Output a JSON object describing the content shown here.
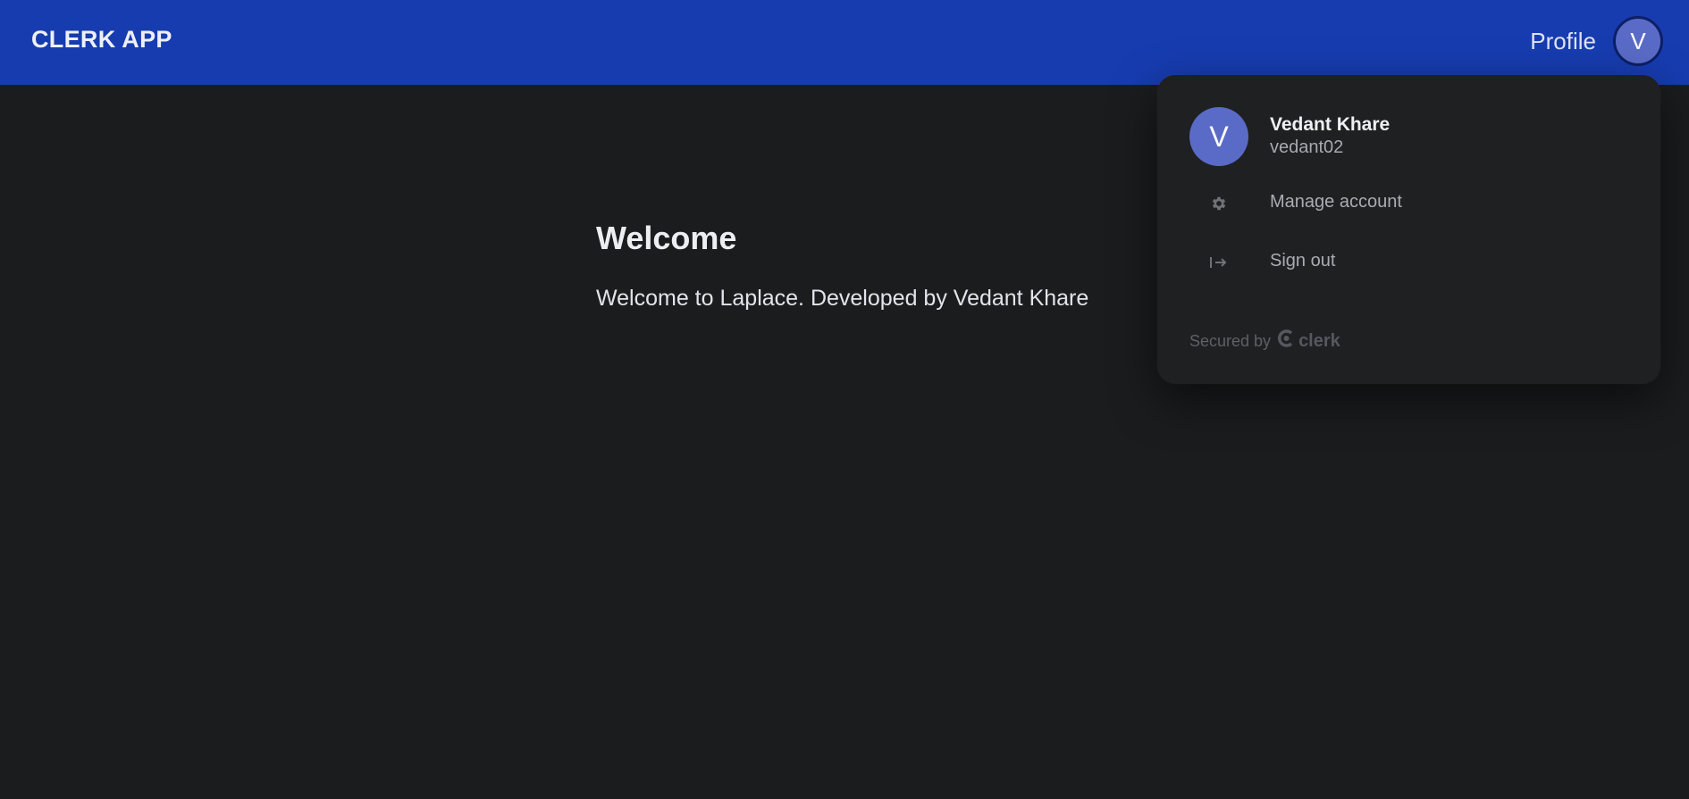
{
  "navbar": {
    "brand": "CLERK APP",
    "profile_link": "Profile",
    "avatar_initial": "V",
    "background_color": "#173cb0"
  },
  "main": {
    "heading": "Welcome",
    "message": "Welcome to Laplace. Developed by Vedant Khare"
  },
  "user_menu": {
    "avatar_initial": "V",
    "avatar_color": "#5a6bc7",
    "name": "Vedant Khare",
    "username": "vedant02",
    "actions": [
      {
        "label": "Manage account",
        "icon": "gear-icon"
      },
      {
        "label": "Sign out",
        "icon": "sign-out-icon"
      }
    ],
    "footer": {
      "secured_by": "Secured by",
      "logo_text": "clerk"
    }
  }
}
